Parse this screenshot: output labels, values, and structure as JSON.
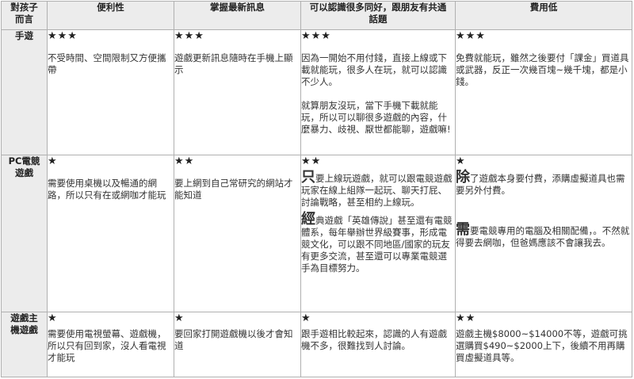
{
  "header": {
    "corner": "對孩子\n而言",
    "col1": "便利性",
    "col2": "掌握最新訊息",
    "col3": "可以認識很多同好，跟朋友有共通話題",
    "col4": "費用低"
  },
  "rows": [
    {
      "label": "手遊",
      "c1_stars": "★★★",
      "c1_text": "不受時間、空間限制又方便攜帶",
      "c2_stars": "★★★",
      "c2_text": "遊戲更新訊息隨時在手機上顯示",
      "c3_stars": "★★★",
      "c3_text": "因為一開始不用付錢，直接上線或下載就能玩，很多人在玩，就可以認識不少人。",
      "c3_text2": "就算朋友沒玩，當下手機下載就能玩，所以可以聊很多遊戲的內容，什麼暴力、歧視、厭世都能聊，遊戲嘛!",
      "c4_stars": "★★★",
      "c4_text": "免費就能玩，雖然之後要付「課金」買道具或武器，反正一次幾百塊~幾千塊，都是小錢。"
    },
    {
      "label": "PC電競\n遊戲",
      "c1_stars": "★",
      "c1_text": "需要使用桌機以及暢通的網路，所以只有在或網咖才能玩",
      "c2_stars": "★★",
      "c2_text": "要上網到自己常研究的網站才能知道",
      "c3_stars": "★★",
      "c3_big1": "只",
      "c3_text": "要上線玩遊戲，就可以跟電競遊戲玩家在線上組隊一起玩、聊天打屁、討論戰略，甚至相約上線玩。",
      "c3_big2": "經",
      "c3_text2": "典遊戲「英雄傳說」甚至還有電競體系，每年舉辦世界級賽事，形成電競文化，可以跟不同地區/國家的玩友有更多交流，甚至還可以專業電競選手為目標努力。",
      "c4_stars": "★",
      "c4_big1": "除",
      "c4_text": "了遊戲本身要付費，添購虛擬道具也需要另外付費。",
      "c4_big2": "需",
      "c4_text2": "要電競專用的電腦及相關配備，。不然就得要去網咖，但爸媽應該不會讓我去。"
    },
    {
      "label": "遊戲主\n機遊戲",
      "c1_stars": "★",
      "c1_text": "需要使用電視螢幕、遊戲機，所以只有回到家，沒人看電視才能玩",
      "c2_stars": "★",
      "c2_text": "要回家打開遊戲機以後才會知道",
      "c3_stars": "★",
      "c3_text": "跟手遊相比較起來，認識的人有遊戲機不多，很難找到人討論。",
      "c4_stars": "★★",
      "c4_text": "遊戲主機$8000~$14000不等，遊戲可挑選購買$490~$2000上下，後續不用再購買虛擬道具等。"
    }
  ]
}
